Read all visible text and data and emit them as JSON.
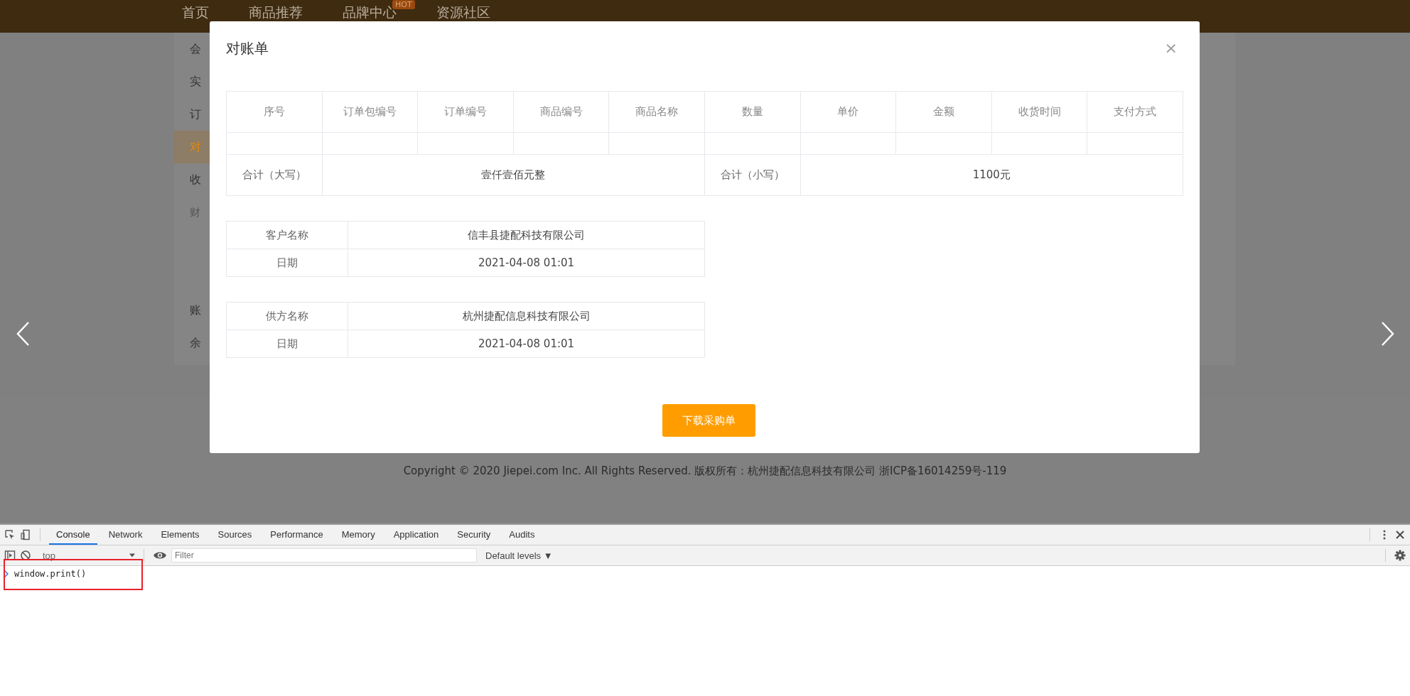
{
  "nav": {
    "items": [
      {
        "label": "首页"
      },
      {
        "label": "商品推荐"
      },
      {
        "label": "品牌中心",
        "badge": "HOT"
      },
      {
        "label": "资源社区"
      }
    ]
  },
  "sidebar": {
    "items": [
      {
        "label": "会",
        "kind": "item",
        "selected": false
      },
      {
        "label": "实",
        "kind": "item",
        "selected": false
      },
      {
        "label": "订",
        "kind": "item",
        "selected": false
      },
      {
        "label": "对",
        "kind": "item",
        "selected": true
      },
      {
        "label": "收",
        "kind": "item",
        "selected": false
      },
      {
        "label": "财",
        "kind": "group",
        "selected": false
      },
      {
        "label": "账",
        "kind": "item",
        "selected": false
      },
      {
        "label": "余",
        "kind": "item",
        "selected": false
      }
    ]
  },
  "footer": {
    "copyright": "Copyright © 2020 Jiepei.com Inc. All Rights Reserved. 版权所有：杭州捷配信息科技有限公司 浙ICP备16014259号-119"
  },
  "modal": {
    "title": "对账单",
    "close": "×",
    "table": {
      "columns": [
        "序号",
        "订单包编号",
        "订单编号",
        "商品编号",
        "商品名称",
        "数量",
        "单价",
        "金额",
        "收货时间",
        "支付方式"
      ],
      "total_upper_label": "合计（大写）",
      "total_upper": "壹仟壹佰元整",
      "total_lower_label": "合计（小写）",
      "total_lower": "1100元"
    },
    "customer": [
      {
        "label": "客户名称",
        "value": "信丰县捷配科技有限公司"
      },
      {
        "label": "日期",
        "value": "2021-04-08 01:01"
      }
    ],
    "supplier": [
      {
        "label": "供方名称",
        "value": "杭州捷配信息科技有限公司"
      },
      {
        "label": "日期",
        "value": "2021-04-08 01:01"
      }
    ],
    "button": "下载采购单"
  },
  "devtools": {
    "tabs": [
      {
        "label": "Console",
        "selected": true
      },
      {
        "label": "Network",
        "selected": false
      },
      {
        "label": "Elements",
        "selected": false
      },
      {
        "label": "Sources",
        "selected": false
      },
      {
        "label": "Performance",
        "selected": false
      },
      {
        "label": "Memory",
        "selected": false
      },
      {
        "label": "Application",
        "selected": false
      },
      {
        "label": "Security",
        "selected": false
      },
      {
        "label": "Audits",
        "selected": false
      }
    ],
    "context": "top",
    "filter_placeholder": "Filter",
    "levels": "Default levels ▼",
    "console_line": "window.print()"
  }
}
